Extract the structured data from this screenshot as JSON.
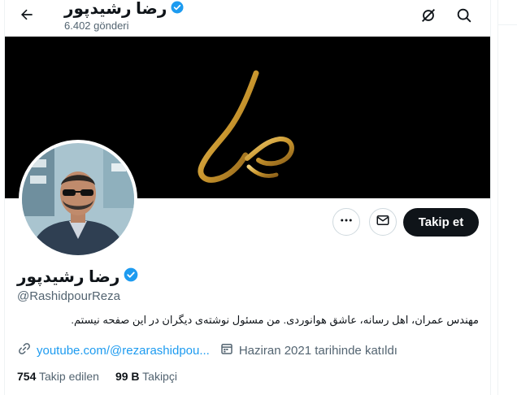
{
  "header": {
    "display_name": "رضا رشیدپور",
    "posts_count": "6.402 gönderi"
  },
  "banner": {
    "bg": "#000000",
    "logo_color": "#c9962e"
  },
  "profile": {
    "display_name": "رضا رشیدپور",
    "handle": "@RashidpourReza",
    "bio": "مهندس عمران، اهل رسانه، عاشق هوانوردی. من مسئول نوشته‌ی دیگران در این صفحه نیستم.",
    "link_text": "youtube.com/@rezarashidpou...",
    "joined": "Haziran 2021 tarihinde katıldı",
    "following_count": "754",
    "following_label": "Takip edilen",
    "followers_count": "99 B",
    "followers_label": "Takipçi"
  },
  "actions": {
    "follow_label": "Takip et"
  },
  "icons": {
    "back": "back-arrow-icon",
    "verified": "verified-badge-icon",
    "grok": "grok-icon",
    "search": "search-icon",
    "more": "more-icon",
    "message": "message-icon",
    "link": "link-icon",
    "calendar": "calendar-icon"
  },
  "colors": {
    "accent": "#1d9bf0",
    "text": "#0f1419",
    "muted": "#536471"
  }
}
